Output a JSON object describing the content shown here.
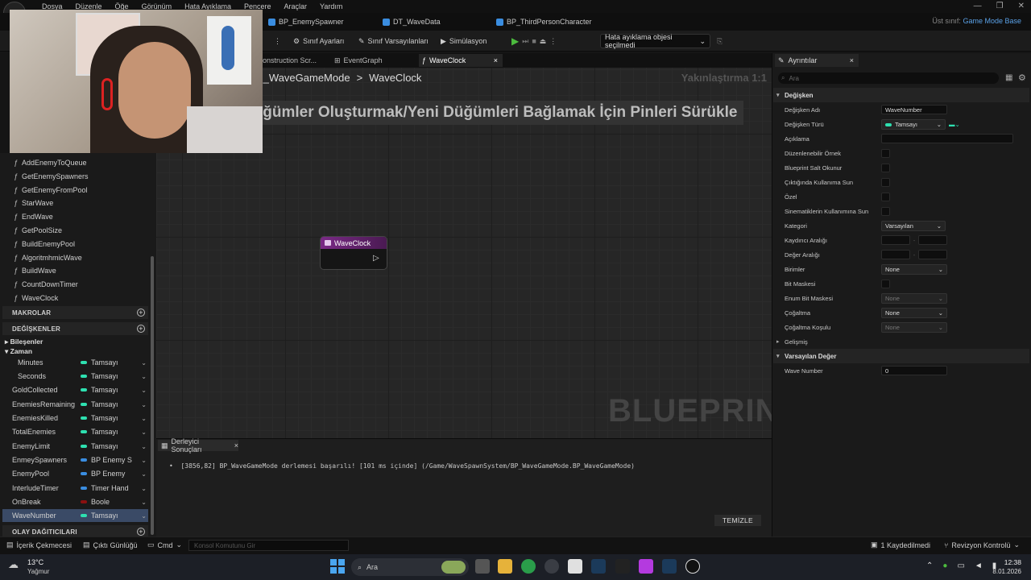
{
  "menu": [
    "Dosya",
    "Düzenle",
    "Öğe",
    "Görünüm",
    "Hata Ayıklama",
    "Pencere",
    "Araçlar",
    "Yardım"
  ],
  "asset_tabs": [
    {
      "label": "BP_EnemySpawner"
    },
    {
      "label": "DT_WaveData"
    },
    {
      "label": "BP_ThirdPersonCharacter"
    }
  ],
  "parent_class": {
    "label": "Üst sınıf:",
    "value": "Game Mode Base"
  },
  "toolbar": {
    "class_settings": "Sınıf Ayarları",
    "class_defaults": "Sınıf Varsayılanları",
    "simulation": "Simülasyon",
    "debug_object": "Hata ayıklama objesi seçilmedi"
  },
  "graph_tabs": [
    "onstruction Scr...",
    "EventGraph",
    "WaveClock"
  ],
  "breadcrumb": {
    "parent": "P_WaveGameMode",
    "current": "WaveClock",
    "sep": ">"
  },
  "zoom_label": "Yakınlaştırma 1:1",
  "graph_hint": "iğümler Oluşturmak/Yeni Düğümleri Bağlamak İçin Pinleri Sürükle",
  "watermark": "BLUEPRINT",
  "node": {
    "title": "WaveClock"
  },
  "functions": [
    "AddEnemyToQueue",
    "GetEnemySpawners",
    "GetEnemyFromPool",
    "StarWave",
    "EndWave",
    "GetPoolSize",
    "BuildEnemyPool",
    "AlgoritmhmicWave",
    "BuildWave",
    "CountDownTimer",
    "WaveClock"
  ],
  "sections": {
    "macros": "MAKROLAR",
    "variables": "DEĞİŞKENLER",
    "dispatchers": "OLAY DAĞITICILARI"
  },
  "categories": {
    "components": "Bileşenler",
    "time": "Zaman"
  },
  "variables": [
    {
      "name": "Minutes",
      "type": "Tamsayı",
      "color": "#2ee0b0"
    },
    {
      "name": "Seconds",
      "type": "Tamsayı",
      "color": "#2ee0b0"
    },
    {
      "name": "GoldCollected",
      "type": "Tamsayı",
      "color": "#2ee0b0"
    },
    {
      "name": "EnemiesRemaining",
      "type": "Tamsayı",
      "color": "#2ee0b0"
    },
    {
      "name": "EnemiesKilled",
      "type": "Tamsayı",
      "color": "#2ee0b0"
    },
    {
      "name": "TotalEnemies",
      "type": "Tamsayı",
      "color": "#2ee0b0"
    },
    {
      "name": "EnemyLimit",
      "type": "Tamsayı",
      "color": "#2ee0b0"
    },
    {
      "name": "EnmeySpawners",
      "type": "BP Enemy S",
      "color": "#3a8de0"
    },
    {
      "name": "EnemyPool",
      "type": "BP Enemy",
      "color": "#3a8de0"
    },
    {
      "name": "InterludeTimer",
      "type": "Timer Hand",
      "color": "#3a8de0"
    },
    {
      "name": "OnBreak",
      "type": "Boole",
      "color": "#8a1010"
    },
    {
      "name": "WaveNumber",
      "type": "Tamsayı",
      "color": "#2ee0b0"
    }
  ],
  "compiler": {
    "tab": "Derleyici Sonuçları",
    "log": "[3856,82] BP_WaveGameMode derlemesi başarılı! [101 ms içinde] (/Game/WaveSpawnSystem/BP_WaveGameMode.BP_WaveGameMode)",
    "clear": "TEMİZLE"
  },
  "details": {
    "tab": "Ayrıntılar",
    "search_placeholder": "Ara",
    "section_variable": "Değişken",
    "variable_name_label": "Değişken Adı",
    "variable_name": "WaveNumber",
    "variable_type_label": "Değişken Türü",
    "variable_type": "Tamsayı",
    "description_label": "Açıklama",
    "instance_editable": "Düzenlenebilir Örnek",
    "blueprint_readonly": "Blueprint Salt Okunur",
    "expose_on_spawn": "Çıktığında Kullanıma Sun",
    "private": "Özel",
    "expose_cinematics": "Sinematiklerin Kullanımına Sun",
    "category_label": "Kategori",
    "category_value": "Varsayılan",
    "slider_range": "Kaydırıcı Aralığı",
    "value_range": "Değer Aralığı",
    "units_label": "Birimler",
    "units_value": "None",
    "bitmask": "Bit Maskesi",
    "bitmask_enum": "Enum Bit Maskesi",
    "bitmask_enum_value": "None",
    "replication": "Çoğaltma",
    "replication_value": "None",
    "replication_cond": "Çoğaltma Koşulu",
    "replication_cond_value": "None",
    "advanced": "Gelişmiş",
    "section_default": "Varsayılan Değer",
    "wave_number_label": "Wave Number",
    "wave_number_value": "0"
  },
  "statusbar": {
    "content_drawer": "İçerik Çekmecesi",
    "output_log": "Çıktı Günlüğü",
    "cmd": "Cmd",
    "console_placeholder": "Konsol Komutunu Gir",
    "unsaved": "1 Kaydedilmedi",
    "revision": "Revizyon Kontrolü"
  },
  "taskbar": {
    "weather_temp": "13°C",
    "weather_desc": "Yağmur",
    "search": "Ara",
    "time": "12:38",
    "date": "8.01.2026"
  }
}
